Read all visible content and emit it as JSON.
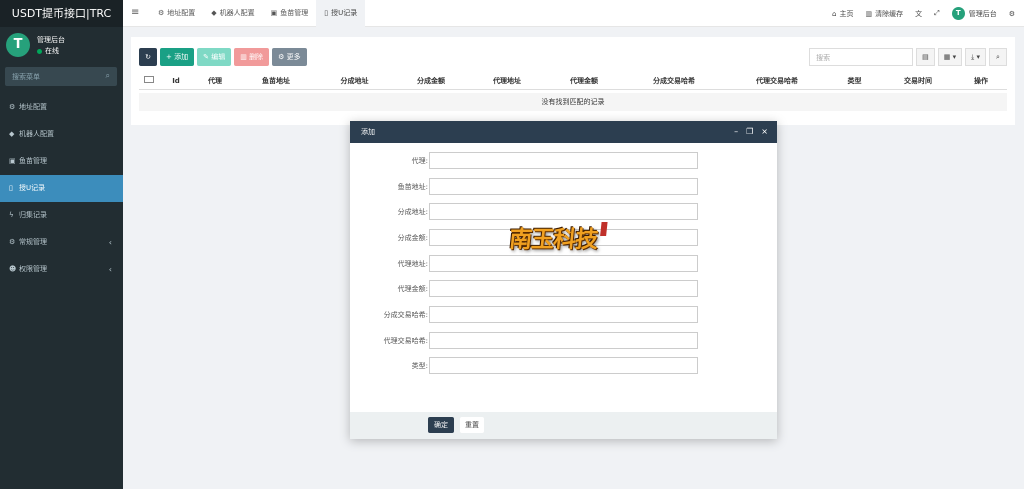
{
  "app": {
    "title": "USDT提币接口|TRC",
    "user_name": "管理后台",
    "user_status": "在线",
    "accent": "#3c8dbc",
    "sidebar_bg": "#222d32"
  },
  "sidebar": {
    "search_placeholder": "搜索菜单",
    "items": [
      {
        "label": "地址配置",
        "icon": "gear-icon"
      },
      {
        "label": "机器人配置",
        "icon": "diamond-icon"
      },
      {
        "label": "鱼苗管理",
        "icon": "lock-icon"
      },
      {
        "label": "授U记录",
        "icon": "bookmark-icon",
        "active": true
      },
      {
        "label": "归集记录",
        "icon": "bolt-icon"
      },
      {
        "label": "常规管理",
        "icon": "cogs-icon",
        "has_children": true
      },
      {
        "label": "权限管理",
        "icon": "group-icon",
        "has_children": true
      }
    ]
  },
  "topbar": {
    "tabs": [
      {
        "label": "地址配置",
        "icon": "gear-icon"
      },
      {
        "label": "机器人配置",
        "icon": "diamond-icon"
      },
      {
        "label": "鱼苗管理",
        "icon": "lock-icon"
      },
      {
        "label": "授U记录",
        "icon": "bookmark-icon",
        "active": true
      }
    ],
    "home_label": "主页",
    "clear_cache_label": "清除缓存",
    "admin_label": "管理后台"
  },
  "toolbar": {
    "add_label": "添加",
    "edit_label": "编辑",
    "delete_label": "删除",
    "more_label": "更多",
    "search_placeholder": "搜索"
  },
  "table": {
    "columns": [
      "Id",
      "代理",
      "鱼苗地址",
      "分成地址",
      "分成金额",
      "代理地址",
      "代理金额",
      "分成交易哈希",
      "代理交易哈希",
      "类型",
      "交易时间",
      "操作"
    ],
    "empty_text": "没有找到匹配的记录"
  },
  "modal": {
    "title": "添加",
    "fields": [
      {
        "label": "代理:",
        "value": ""
      },
      {
        "label": "鱼苗地址:",
        "value": ""
      },
      {
        "label": "分成地址:",
        "value": ""
      },
      {
        "label": "分成金额:",
        "value": ""
      },
      {
        "label": "代理地址:",
        "value": ""
      },
      {
        "label": "代理金额:",
        "value": ""
      },
      {
        "label": "分成交易哈希:",
        "value": ""
      },
      {
        "label": "代理交易哈希:",
        "value": ""
      },
      {
        "label": "类型:",
        "value": ""
      }
    ],
    "ok_label": "确定",
    "reset_label": "重置"
  },
  "watermark": {
    "text": "南玉科技"
  }
}
